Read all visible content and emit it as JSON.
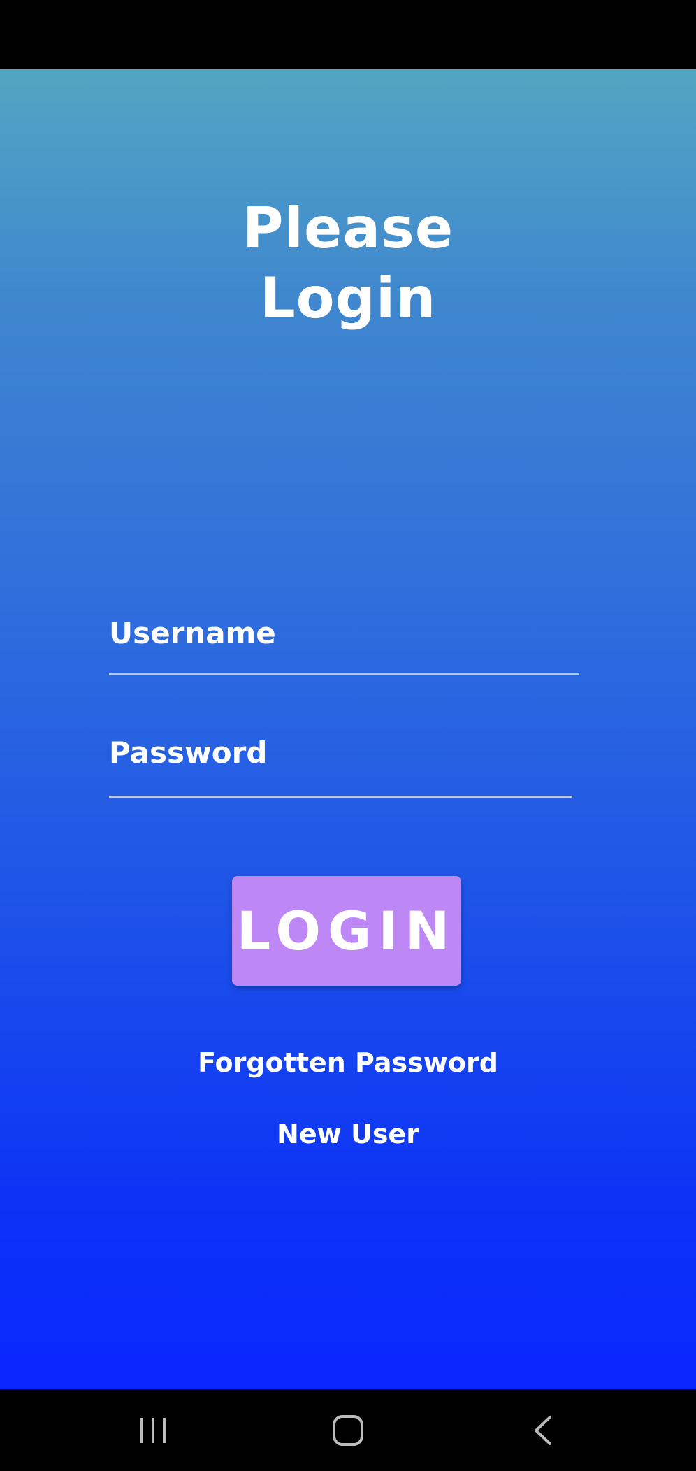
{
  "title": {
    "line1": "Please",
    "line2": "Login"
  },
  "form": {
    "username_placeholder": "Username",
    "password_placeholder": "Password",
    "login_label": "LOGIN"
  },
  "links": {
    "forgotten_password": "Forgotten Password",
    "new_user": "New User"
  },
  "nav": {
    "recents_icon": "recents-icon",
    "home_icon": "home-icon",
    "back_icon": "back-icon"
  },
  "colors": {
    "gradient_top": "#52a6c2",
    "gradient_bottom": "#0a26ff",
    "button": "#bd88f6",
    "text": "#ffffff"
  }
}
